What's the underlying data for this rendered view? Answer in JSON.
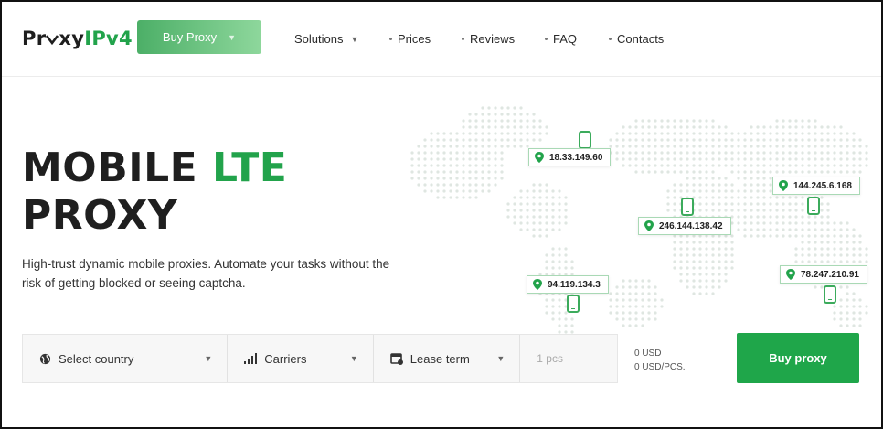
{
  "header": {
    "logo_prefix": "Pr",
    "logo_mid": "xy",
    "logo_accent": "IPv4",
    "buy_button": "Buy Proxy",
    "nav": {
      "solutions": "Solutions",
      "prices": "Prices",
      "reviews": "Reviews",
      "faq": "FAQ",
      "contacts": "Contacts"
    }
  },
  "hero": {
    "title_line1_a": "MOBILE",
    "title_line1_b": "LTE",
    "title_line2": "PROXY",
    "subtitle": "High-trust dynamic mobile proxies. Automate your tasks without the risk of getting blocked or seeing captcha."
  },
  "map": {
    "ips": [
      "18.33.149.60",
      "144.245.6.168",
      "246.144.138.42",
      "94.119.134.3",
      "78.247.210.91"
    ]
  },
  "form": {
    "country": "Select country",
    "carriers": "Carriers",
    "lease": "Lease term",
    "qty_placeholder": "1 pcs",
    "total": "0 USD",
    "per_unit": "0 USD/PCS.",
    "buy": "Buy proxy"
  },
  "colors": {
    "accent": "#22a34b",
    "button": "#1fa64a"
  },
  "icons": [
    "logo-shield-icon",
    "chevron-down-icon",
    "globe-icon",
    "signal-bars-icon",
    "calendar-icon",
    "location-pin-icon",
    "phone-icon"
  ]
}
